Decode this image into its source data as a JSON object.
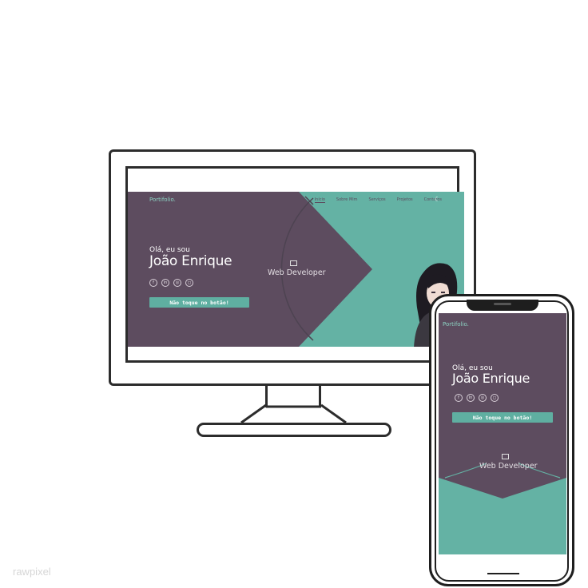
{
  "colors": {
    "purple": "#5d4c5f",
    "teal": "#64b2a4",
    "button": "#5fafa1",
    "logo": "#8dd4c4",
    "frame": "#2c2c2c"
  },
  "desktop": {
    "logo": "Portifolio.",
    "nav": [
      "Início",
      "Sobre Mim",
      "Serviços",
      "Projetos",
      "Contatos"
    ],
    "theme_icon": "moon-icon",
    "greeting": "Olá, eu sou",
    "name": "João Enrique",
    "socials": [
      "facebook-icon",
      "linkedin-icon",
      "github-icon",
      "instagram-icon"
    ],
    "button_label": "Não toque no botão!",
    "role": "Web Developer"
  },
  "mobile": {
    "logo": "Portifolio.",
    "greeting": "Olá, eu sou",
    "name": "João Enrique",
    "socials": [
      "facebook-icon",
      "linkedin-icon",
      "github-icon",
      "instagram-icon"
    ],
    "button_label": "Não toque no botão!",
    "role": "Web Developer"
  },
  "watermark": "rawpixel"
}
